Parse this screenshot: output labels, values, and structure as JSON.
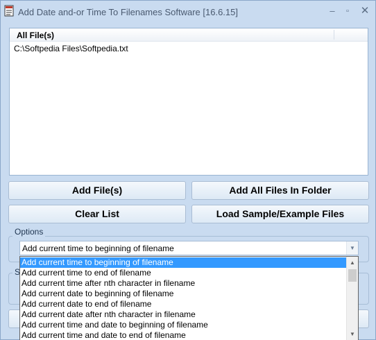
{
  "window": {
    "title": "Add Date and-or Time To Filenames Software [16.6.15]",
    "icon": "app-document-icon",
    "controls": {
      "minimize": "–",
      "maximize": "▫",
      "close": "✕"
    }
  },
  "file_list": {
    "column_header": "All File(s)",
    "rows": [
      "C:\\Softpedia Files\\Softpedia.txt"
    ]
  },
  "buttons": {
    "add_files": "Add File(s)",
    "add_all_folder": "Add All Files In Folder",
    "clear_list": "Clear List",
    "load_sample": "Load Sample/Example Files"
  },
  "options": {
    "legend": "Options",
    "selected": "Add current time to beginning of filename",
    "dropdown_items": [
      "Add current time to beginning of filename",
      "Add current time to end of filename",
      "Add current time after nth character in filename",
      "Add current date to beginning of filename",
      "Add current date to end of filename",
      "Add current date after nth character in filename",
      "Add current time and date to beginning of filename",
      "Add current time and date to end of filename"
    ]
  },
  "partial_group": {
    "legend_fragment": "S"
  },
  "colors": {
    "window_bg": "#c9dbf0",
    "selection": "#3399ff"
  }
}
